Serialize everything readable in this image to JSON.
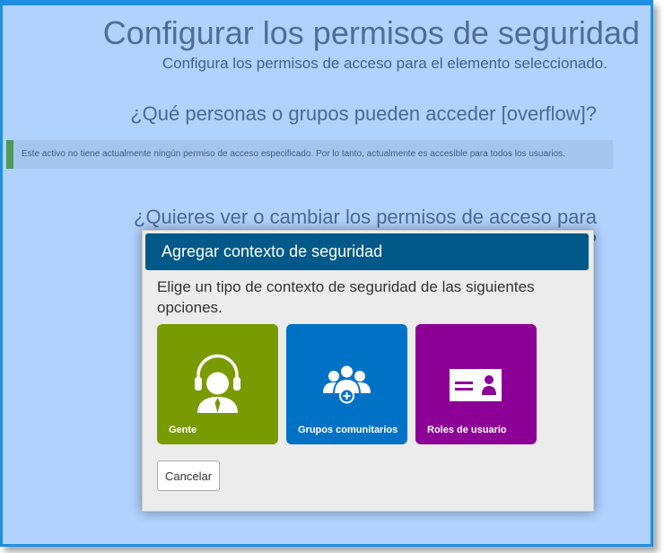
{
  "page": {
    "title": "Configurar los permisos de seguridad",
    "subtitle": "Configura los permisos de acceso para el elemento seleccionado.",
    "question_access": "¿Qué personas o grupos pueden acceder [overflow]?",
    "notice": "Este activo no tiene actualmente ningún permiso de acceso especificado. Por lo tanto, actualmente es accesible para todos los usuarios.",
    "question_change": "¿Quieres ver o cambiar los permisos de acceso para [overflow]?"
  },
  "dialog": {
    "title": "Agregar contexto de seguridad",
    "prompt": "Elige un tipo de contexto de seguridad de las siguientes opciones.",
    "options": [
      {
        "label": "Gente",
        "icon": "person-headset-icon",
        "color": "#7a9a01"
      },
      {
        "label": "Grupos comunitarios",
        "icon": "community-group-icon",
        "color": "#0072c6"
      },
      {
        "label": "Roles de usuario",
        "icon": "user-role-card-icon",
        "color": "#8c0095"
      }
    ],
    "cancel_label": "Cancelar"
  },
  "colors": {
    "background": "#b1d2fd",
    "frame_border": "#1e8fe0",
    "dialog_header": "#005988",
    "notice_accent": "#4d9a5b"
  }
}
